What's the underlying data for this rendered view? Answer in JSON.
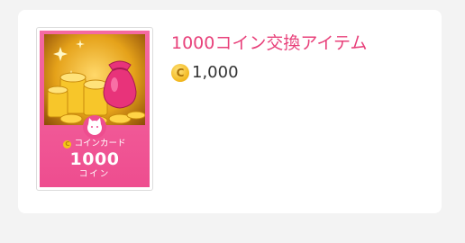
{
  "item": {
    "title": "1000コイン交換アイテム",
    "price": "1,000",
    "price_icon": "coin-icon",
    "title_color": "#e8407a"
  },
  "thumbnail": {
    "card_label": "コインカード",
    "amount": "1000",
    "unit": "コイン",
    "icon": "coin-icon"
  }
}
